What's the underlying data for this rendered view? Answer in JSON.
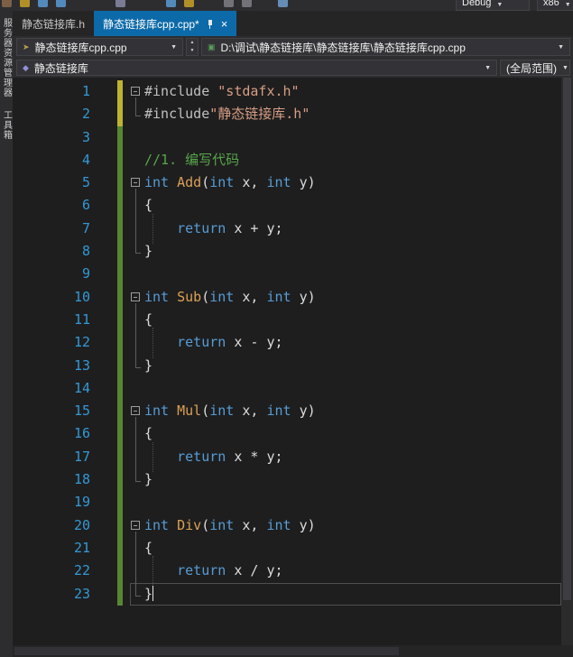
{
  "toolbar": {
    "debug_dropdown": "Debug",
    "platform_dropdown": "x86",
    "icons": [
      {
        "name": "new-file-icon",
        "color": "#8a6a4a"
      },
      {
        "name": "open-file-icon",
        "color": "#c9a227"
      },
      {
        "name": "save-icon",
        "color": "#5b9bd5"
      },
      {
        "name": "save-all-icon",
        "color": "#5b9bd5"
      },
      {
        "name": "window-layout-icon",
        "color": "#8a8aa8"
      },
      {
        "name": "undo-icon",
        "color": "#5b9bd5"
      },
      {
        "name": "redo-icon",
        "color": "#c9a227"
      },
      {
        "name": "navigate-back-icon",
        "color": "#7f7f85"
      },
      {
        "name": "navigate-forward-icon",
        "color": "#7f7f85"
      },
      {
        "name": "run-icon",
        "color": "#6f9fce"
      }
    ]
  },
  "tabs": [
    {
      "label": "静态链接库.h",
      "active": false
    },
    {
      "label": "静态链接库cpp.cpp*",
      "active": true
    }
  ],
  "navbar1": {
    "file_dropdown": "静态链接库cpp.cpp",
    "path_dropdown": "D:\\调试\\静态链接库\\静态链接库\\静态链接库cpp.cpp"
  },
  "scopebar": {
    "type_dropdown": "静态链接库",
    "scope_dropdown": "(全局范围)"
  },
  "sidebar": {
    "items": [
      {
        "label": "服务器资源管理器"
      },
      {
        "label": "工具箱"
      }
    ]
  },
  "editor": {
    "lines": [
      {
        "num": 1,
        "fold": "start",
        "mark": "yellow",
        "tokens": [
          {
            "t": "pp",
            "s": "#include"
          },
          {
            "t": "pl",
            "s": " "
          },
          {
            "t": "str",
            "s": "\"stdafx.h\""
          }
        ]
      },
      {
        "num": 2,
        "fold": "end",
        "mark": "yellow",
        "tokens": [
          {
            "t": "pp",
            "s": "#include"
          },
          {
            "t": "str",
            "s": "\"静态链接库.h\""
          }
        ]
      },
      {
        "num": 3,
        "fold": "none",
        "mark": "green",
        "tokens": []
      },
      {
        "num": 4,
        "fold": "none",
        "mark": "green",
        "tokens": [
          {
            "t": "cm",
            "s": "//1. 编写代码"
          }
        ]
      },
      {
        "num": 5,
        "fold": "start",
        "mark": "green",
        "tokens": [
          {
            "t": "kw",
            "s": "int"
          },
          {
            "t": "pl",
            "s": " "
          },
          {
            "t": "fn",
            "s": "Add"
          },
          {
            "t": "pl",
            "s": "("
          },
          {
            "t": "kw",
            "s": "int"
          },
          {
            "t": "pl",
            "s": " x, "
          },
          {
            "t": "kw",
            "s": "int"
          },
          {
            "t": "pl",
            "s": " y)"
          }
        ]
      },
      {
        "num": 6,
        "fold": "mid",
        "mark": "green",
        "tokens": [
          {
            "t": "pl",
            "s": "{"
          }
        ]
      },
      {
        "num": 7,
        "fold": "mid",
        "mark": "green",
        "tokens": [
          {
            "t": "guide"
          },
          {
            "t": "kw",
            "s": "return"
          },
          {
            "t": "pl",
            "s": " x + y;"
          }
        ]
      },
      {
        "num": 8,
        "fold": "end",
        "mark": "green",
        "tokens": [
          {
            "t": "pl",
            "s": "}"
          }
        ]
      },
      {
        "num": 9,
        "fold": "none",
        "mark": "green",
        "tokens": []
      },
      {
        "num": 10,
        "fold": "start",
        "mark": "green",
        "tokens": [
          {
            "t": "kw",
            "s": "int"
          },
          {
            "t": "pl",
            "s": " "
          },
          {
            "t": "fn",
            "s": "Sub"
          },
          {
            "t": "pl",
            "s": "("
          },
          {
            "t": "kw",
            "s": "int"
          },
          {
            "t": "pl",
            "s": " x, "
          },
          {
            "t": "kw",
            "s": "int"
          },
          {
            "t": "pl",
            "s": " y)"
          }
        ]
      },
      {
        "num": 11,
        "fold": "mid",
        "mark": "green",
        "tokens": [
          {
            "t": "pl",
            "s": "{"
          }
        ]
      },
      {
        "num": 12,
        "fold": "mid",
        "mark": "green",
        "tokens": [
          {
            "t": "guide"
          },
          {
            "t": "kw",
            "s": "return"
          },
          {
            "t": "pl",
            "s": " x - y;"
          }
        ]
      },
      {
        "num": 13,
        "fold": "end",
        "mark": "green",
        "tokens": [
          {
            "t": "pl",
            "s": "}"
          }
        ]
      },
      {
        "num": 14,
        "fold": "none",
        "mark": "green",
        "tokens": []
      },
      {
        "num": 15,
        "fold": "start",
        "mark": "green",
        "tokens": [
          {
            "t": "kw",
            "s": "int"
          },
          {
            "t": "pl",
            "s": " "
          },
          {
            "t": "fn",
            "s": "Mul"
          },
          {
            "t": "pl",
            "s": "("
          },
          {
            "t": "kw",
            "s": "int"
          },
          {
            "t": "pl",
            "s": " x, "
          },
          {
            "t": "kw",
            "s": "int"
          },
          {
            "t": "pl",
            "s": " y)"
          }
        ]
      },
      {
        "num": 16,
        "fold": "mid",
        "mark": "green",
        "tokens": [
          {
            "t": "pl",
            "s": "{"
          }
        ]
      },
      {
        "num": 17,
        "fold": "mid",
        "mark": "green",
        "tokens": [
          {
            "t": "guide"
          },
          {
            "t": "kw",
            "s": "return"
          },
          {
            "t": "pl",
            "s": " x * y;"
          }
        ]
      },
      {
        "num": 18,
        "fold": "end",
        "mark": "green",
        "tokens": [
          {
            "t": "pl",
            "s": "}"
          }
        ]
      },
      {
        "num": 19,
        "fold": "none",
        "mark": "green",
        "tokens": []
      },
      {
        "num": 20,
        "fold": "start",
        "mark": "green",
        "tokens": [
          {
            "t": "kw",
            "s": "int"
          },
          {
            "t": "pl",
            "s": " "
          },
          {
            "t": "fn",
            "s": "Div"
          },
          {
            "t": "pl",
            "s": "("
          },
          {
            "t": "kw",
            "s": "int"
          },
          {
            "t": "pl",
            "s": " x, "
          },
          {
            "t": "kw",
            "s": "int"
          },
          {
            "t": "pl",
            "s": " y)"
          }
        ]
      },
      {
        "num": 21,
        "fold": "mid",
        "mark": "green",
        "tokens": [
          {
            "t": "pl",
            "s": "{"
          }
        ]
      },
      {
        "num": 22,
        "fold": "mid",
        "mark": "green",
        "tokens": [
          {
            "t": "guide"
          },
          {
            "t": "kw",
            "s": "return"
          },
          {
            "t": "pl",
            "s": " x / y;"
          }
        ]
      },
      {
        "num": 23,
        "fold": "end",
        "mark": "green",
        "current": true,
        "tokens": [
          {
            "t": "pl",
            "s": "}"
          },
          {
            "t": "cursor"
          }
        ]
      }
    ]
  }
}
